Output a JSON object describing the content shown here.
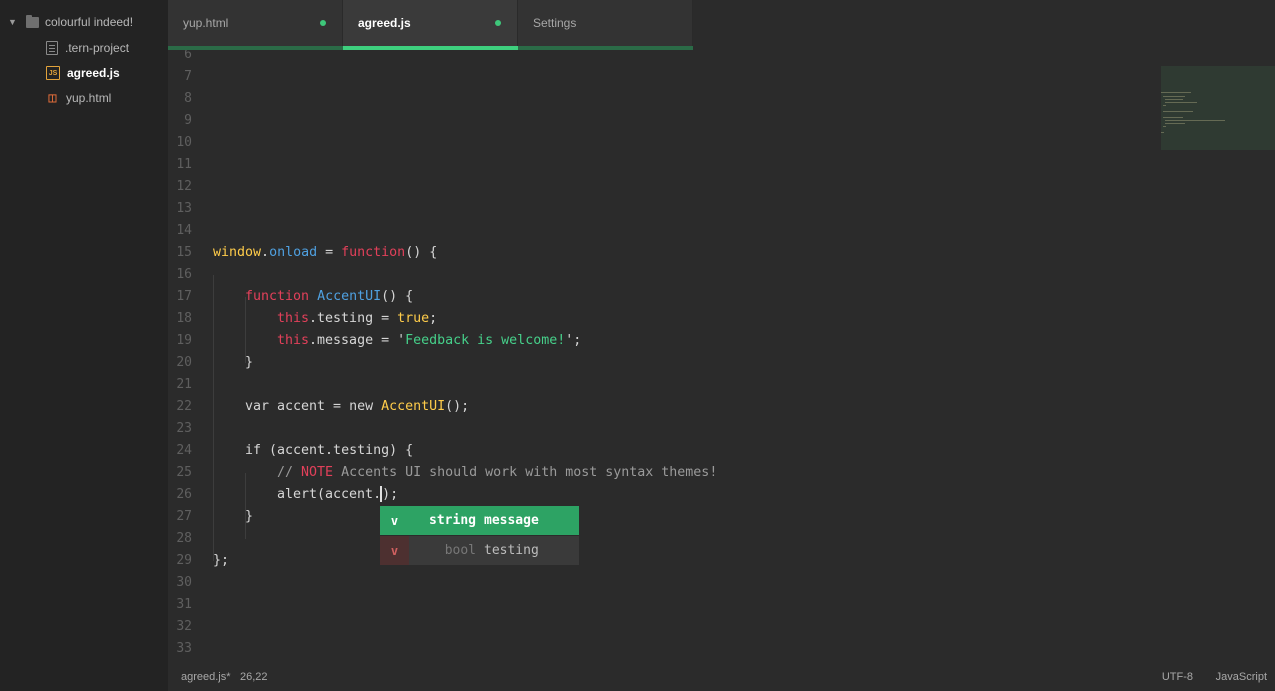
{
  "tree": {
    "root_label": "colourful indeed!",
    "files": [
      {
        "name": ".tern-project",
        "icon": "file-text-icon"
      },
      {
        "name": "agreed.js",
        "icon": "js-file-icon",
        "active": true
      },
      {
        "name": "yup.html",
        "icon": "html5-file-icon"
      }
    ]
  },
  "tabs": [
    {
      "label": "yup.html",
      "modified": true
    },
    {
      "label": "agreed.js",
      "modified": true,
      "active": true
    },
    {
      "label": "Settings",
      "modified": false
    }
  ],
  "editor": {
    "first_line_number": 6,
    "line_numbers": [
      "6",
      "7",
      "8",
      "9",
      "10",
      "11",
      "12",
      "13",
      "14",
      "15",
      "16",
      "17",
      "18",
      "19",
      "20",
      "21",
      "22",
      "23",
      "24",
      "25",
      "26",
      "27",
      "28",
      "29",
      "30",
      "31",
      "32",
      "33"
    ],
    "code": {
      "l15": {
        "a": "window",
        "b": ".",
        "c": "onload",
        "d": " = ",
        "e": "function",
        "f": "() {"
      },
      "l17": {
        "a": "function",
        "b": " ",
        "c": "AccentUI",
        "d": "() {"
      },
      "l18": {
        "a": "this",
        "b": ".testing = ",
        "c": "true",
        "d": ";"
      },
      "l19": {
        "a": "this",
        "b": ".message = '",
        "c": "Feedback is welcome!",
        "d": "';"
      },
      "l20": "}",
      "l22": {
        "a": "var accent = new ",
        "b": "AccentUI",
        "c": "();"
      },
      "l24": "if (accent.testing) {",
      "l25": {
        "a": "// ",
        "b": "NOTE",
        "c": " Accents UI should work with most syntax themes!"
      },
      "l26": {
        "a": "alert(accent.",
        "b": ");"
      },
      "l27": "}",
      "l29": "};"
    }
  },
  "autocomplete": [
    {
      "kind": "v",
      "type": "string",
      "name": "message",
      "selected": true
    },
    {
      "kind": "v",
      "type": "bool",
      "name": "testing",
      "selected": false
    }
  ],
  "status": {
    "file": "agreed.js*",
    "cursor": "26,22",
    "encoding": "UTF-8",
    "grammar": "JavaScript"
  },
  "colors": {
    "accent": "#3ed07e",
    "keyword": "#e2405a",
    "function": "#ffcc4a",
    "property": "#4fa0e0",
    "string": "#46d08a"
  }
}
